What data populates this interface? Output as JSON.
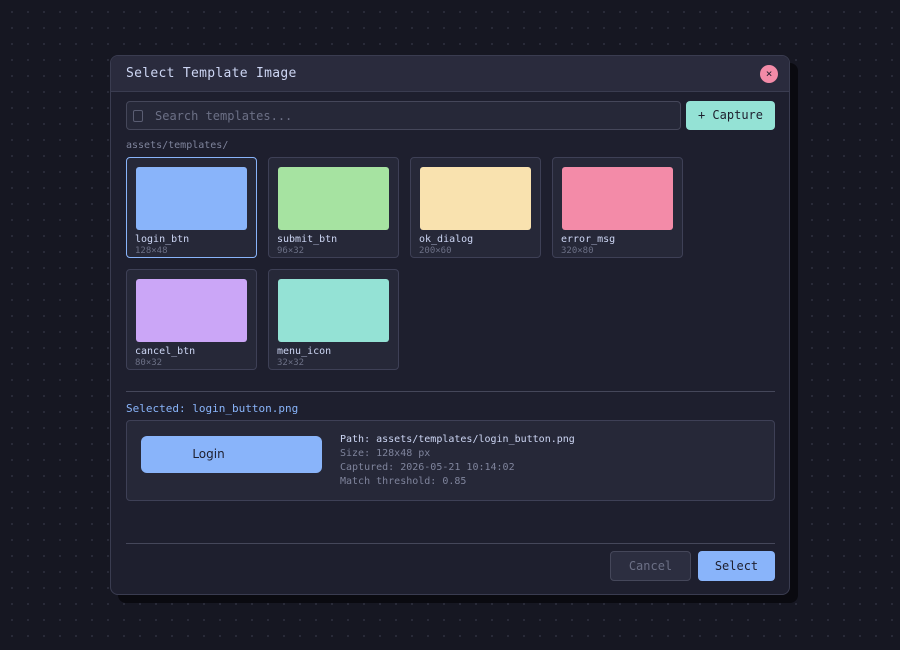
{
  "dialog": {
    "title": "Select Template Image",
    "close_label": "×"
  },
  "search": {
    "placeholder": "Search templates...",
    "value": "",
    "icon": "search-icon"
  },
  "toolbar": {
    "capture_label": "+ Capture"
  },
  "browser": {
    "path": "assets/templates/"
  },
  "templates": [
    {
      "name": "login_btn",
      "size": "128×48",
      "color": "#89b4fa",
      "selected": true
    },
    {
      "name": "submit_btn",
      "size": "96×32",
      "color": "#a6e3a1",
      "selected": false
    },
    {
      "name": "ok_dialog",
      "size": "200×60",
      "color": "#f9e2af",
      "selected": false
    },
    {
      "name": "error_msg",
      "size": "320×80",
      "color": "#f38ba8",
      "selected": false
    },
    {
      "name": "cancel_btn",
      "size": "80×32",
      "color": "#cba6f7",
      "selected": false
    },
    {
      "name": "menu_icon",
      "size": "32×32",
      "color": "#94e2d5",
      "selected": false
    }
  ],
  "selection": {
    "label": "Selected: login_button.png",
    "preview_text": "Login",
    "path": "Path: assets/templates/login_button.png",
    "size": "Size: 128x48 px",
    "captured": "Captured: 2026-05-21  10:14:02",
    "threshold": "Match threshold: 0.85"
  },
  "footer": {
    "cancel_label": "Cancel",
    "select_label": "Select"
  },
  "colors": {
    "accent": "#89b4fa",
    "capture": "#94e2d5",
    "close": "#f38ba8",
    "background": "#1e1f2e"
  }
}
